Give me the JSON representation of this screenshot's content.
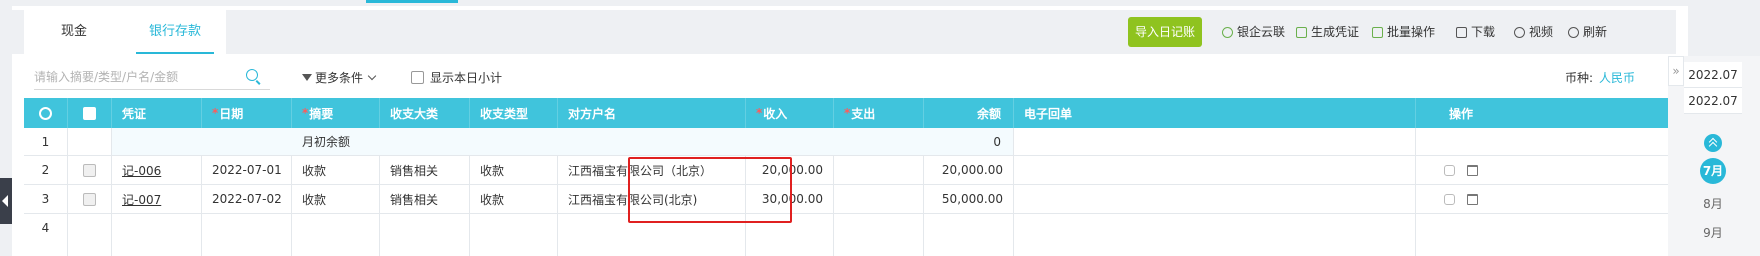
{
  "tabs": {
    "cash": "现金",
    "bank": "银行存款"
  },
  "toolbar": {
    "import": "导入日记账",
    "bank_cloud": "银企云联",
    "generate_voucher": "生成凭证",
    "batch": "批量操作",
    "download": "下载",
    "video": "视频",
    "refresh": "刷新"
  },
  "filters": {
    "search_placeholder": "请输入摘要/类型/户名/金额",
    "more_conditions": "更多条件",
    "show_daily_subtotal": "显示本日小计",
    "currency_label": "币种:",
    "currency_value": "人民币"
  },
  "table": {
    "columns": {
      "voucher": "凭证",
      "date": "日期",
      "summary": "摘要",
      "category": "收支大类",
      "type": "收支类型",
      "counterparty": "对方户名",
      "income": "收入",
      "expense": "支出",
      "balance": "余额",
      "receipt": "电子回单",
      "actions": "操作"
    },
    "opening_row": {
      "index": "1",
      "label": "月初余额",
      "balance": "0"
    },
    "rows": [
      {
        "index": "2",
        "voucher": "记-006",
        "date": "2022-07-01",
        "summary": "收款",
        "category": "销售相关",
        "type": "收款",
        "counterparty": "江西福宝有限公司（北京）",
        "income": "20,000.00",
        "expense": "",
        "balance": "20,000.00"
      },
      {
        "index": "3",
        "voucher": "记-007",
        "date": "2022-07-02",
        "summary": "收款",
        "category": "销售相关",
        "type": "收款",
        "counterparty": "江西福宝有限公司(北京)",
        "income": "30,000.00",
        "expense": "",
        "balance": "50,000.00"
      }
    ],
    "empty_row_index": "4"
  },
  "sidebar": {
    "periods": [
      "2022.07",
      "2022.07"
    ],
    "months": {
      "active": "7月",
      "next1": "8月",
      "next2": "9月"
    }
  }
}
